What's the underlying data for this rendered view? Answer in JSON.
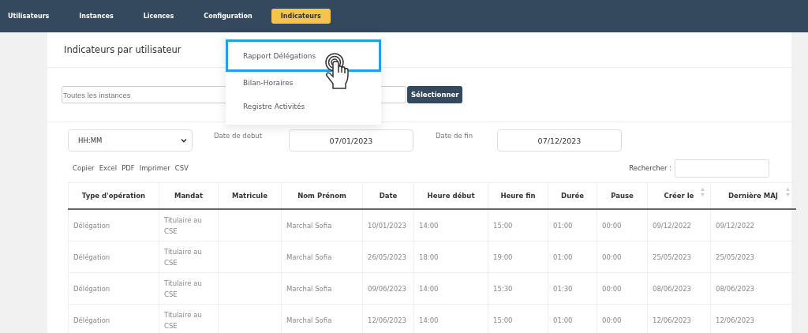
{
  "nav": [
    {
      "label": "Utilisateurs",
      "selected": false
    },
    {
      "label": "Instances",
      "selected": false
    },
    {
      "label": "Licences",
      "selected": false
    },
    {
      "label": "Configuration",
      "selected": false
    },
    {
      "label": "Indicateurs",
      "selected": true
    }
  ],
  "dropdown": [
    {
      "label": "Rapport Délégations",
      "selected": true
    },
    {
      "label": "Bilan-Horaires",
      "selected": false
    },
    {
      "label": "Registre Activités",
      "selected": false
    }
  ],
  "card_title": "Indicateurs par utilisateur",
  "instance_field": {
    "placeholder": "Toutes les instances"
  },
  "select_button": "Sélectionner",
  "format_select": {
    "value": "HH:MM"
  },
  "date_start": {
    "label": "Date de debut",
    "value": "07/01/2023"
  },
  "date_end": {
    "label": "Date de fin",
    "value": "07/12/2023"
  },
  "export_buttons": [
    "Copier",
    "Excel",
    "PDF",
    "Imprimer",
    "CSV"
  ],
  "search": {
    "label": "Rechercher :"
  },
  "table": {
    "columns": [
      {
        "label": "Type d'opération",
        "sortable": false
      },
      {
        "label": "Mandat",
        "sortable": false
      },
      {
        "label": "Matricule",
        "sortable": false
      },
      {
        "label": "Nom Prénom",
        "sortable": false
      },
      {
        "label": "Date",
        "sortable": false
      },
      {
        "label": "Heure début",
        "sortable": false
      },
      {
        "label": "Heure fin",
        "sortable": false
      },
      {
        "label": "Durée",
        "sortable": false
      },
      {
        "label": "Pause",
        "sortable": false
      },
      {
        "label": "Créer le",
        "sortable": true
      },
      {
        "label": "Dernière MAJ",
        "sortable": true
      }
    ],
    "rows": [
      [
        "Délégation",
        "Titulaire au CSE",
        "",
        "Marchal Sofia",
        "10/01/2023",
        "14:00",
        "15:00",
        "01:00",
        "00:00",
        "09/12/2022",
        "09/12/2022"
      ],
      [
        "Délégation",
        "Titulaire au CSE",
        "",
        "Marchal Sofia",
        "26/05/2023",
        "18:00",
        "19:00",
        "01:00",
        "00:00",
        "25/05/2023",
        "25/05/2023"
      ],
      [
        "Délégation",
        "Titulaire au CSE",
        "",
        "Marchal Sofia",
        "09/06/2023",
        "14:00",
        "15:30",
        "01:30",
        "00:00",
        "08/06/2023",
        "08/06/2023"
      ],
      [
        "Délégation",
        "Titulaire au CSE",
        "",
        "Marchal Sofia",
        "12/06/2023",
        "14:00",
        "15:00",
        "01:00",
        "00:00",
        "12/06/2023",
        "12/06/2023"
      ]
    ]
  }
}
